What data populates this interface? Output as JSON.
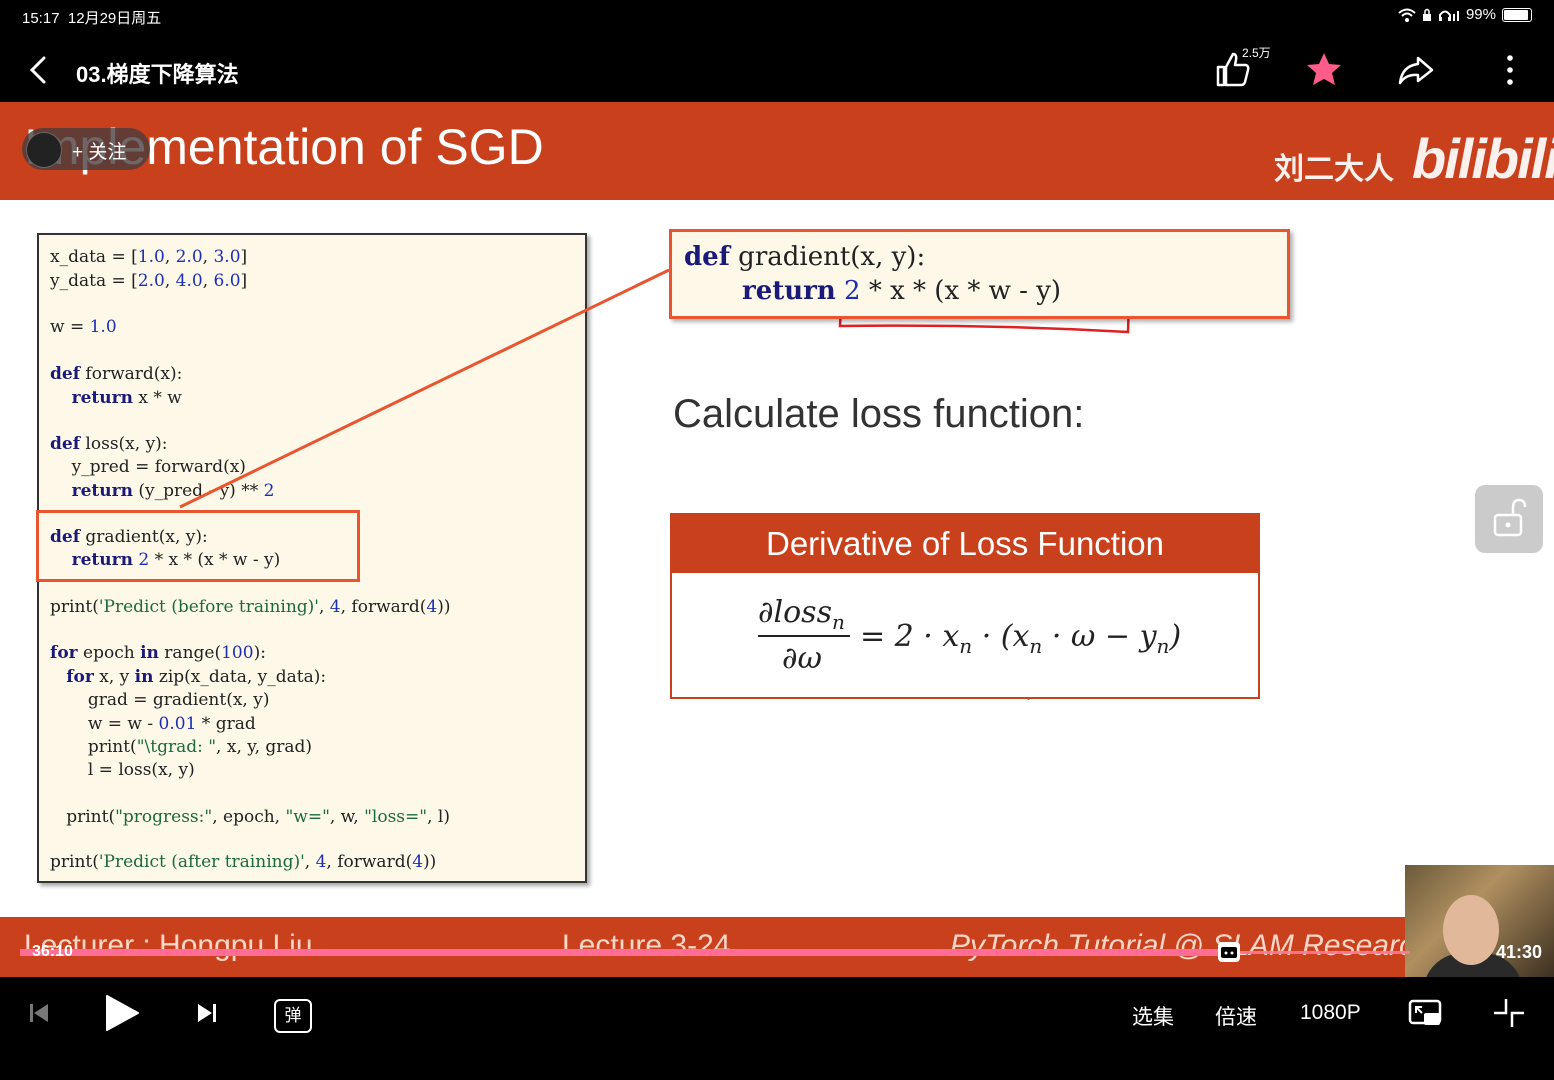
{
  "status": {
    "time": "15:17",
    "date": "12月29日周五",
    "battery": "99%"
  },
  "header": {
    "title": "03.梯度下降算法",
    "like_count": "2.5万"
  },
  "slide": {
    "title": "Implementation of SGD",
    "follow_label": "+ 关注",
    "author": "刘二大人",
    "brand": "bilibili",
    "calc_heading": "Calculate loss function:",
    "derivative_title": "Derivative of Loss Function",
    "footer_lecturer": "Lecturer : Hongpu Liu",
    "footer_lecture": "Lecture 3-24",
    "footer_tutorial": "PyTorch Tutorial @ SLAM Research Group"
  },
  "player": {
    "current_time": "36:10",
    "total_time": "41:30",
    "progress": 0.87,
    "episodes_label": "选集",
    "speed_label": "倍速",
    "quality_label": "1080P",
    "danmaku_label": "弹"
  },
  "colors": {
    "accent": "#c8401c",
    "highlight": "#e85530",
    "like": "#ff5c8a"
  }
}
